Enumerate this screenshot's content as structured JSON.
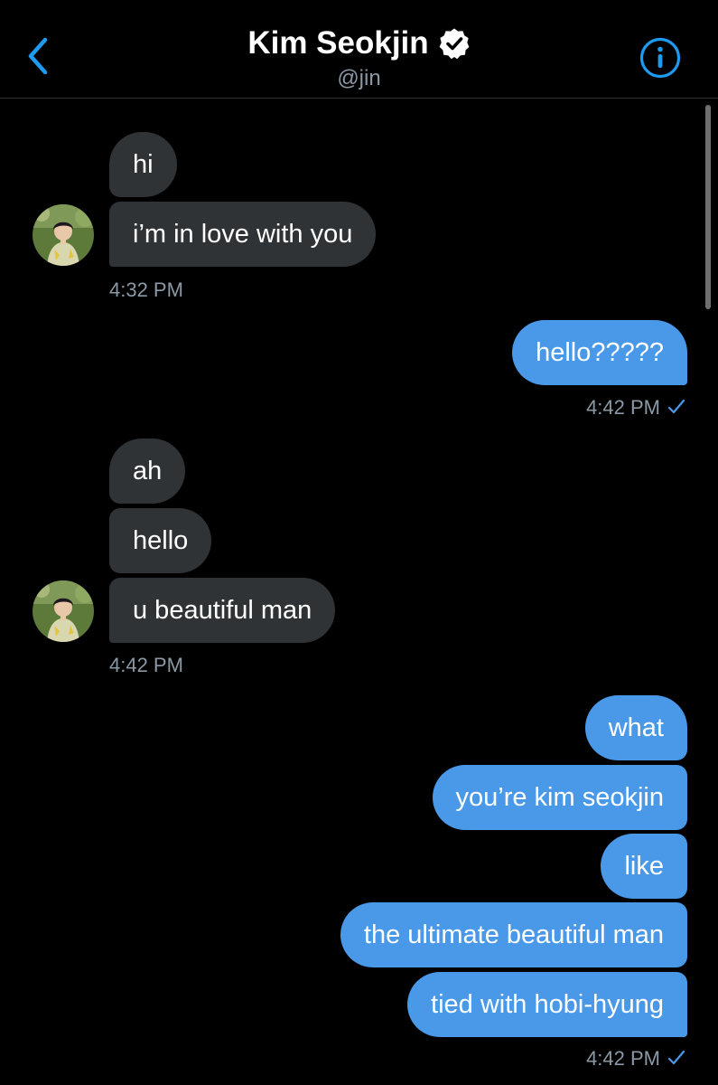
{
  "header": {
    "name": "Kim Seokjin",
    "handle": "@jin",
    "verified": true,
    "back_icon": "chevron-left-icon",
    "info_icon": "info-circle-icon"
  },
  "colors": {
    "background": "#000000",
    "received_bubble": "#2f3336",
    "sent_bubble": "#4a99e9",
    "accent": "#1d9bf0",
    "timestamp": "#8b98a5"
  },
  "messages": {
    "group1": {
      "items": [
        "hi",
        "i’m in love with you"
      ],
      "time": "4:32 PM"
    },
    "group2": {
      "items": [
        "hello?????"
      ],
      "time": "4:42 PM"
    },
    "group3": {
      "items": [
        "ah",
        "hello",
        "u beautiful man"
      ],
      "time": "4:42 PM"
    },
    "group4": {
      "items": [
        "what",
        "you’re kim seokjin",
        "like",
        "the ultimate beautiful man",
        "tied with hobi-hyung"
      ],
      "time": "4:42 PM"
    }
  }
}
